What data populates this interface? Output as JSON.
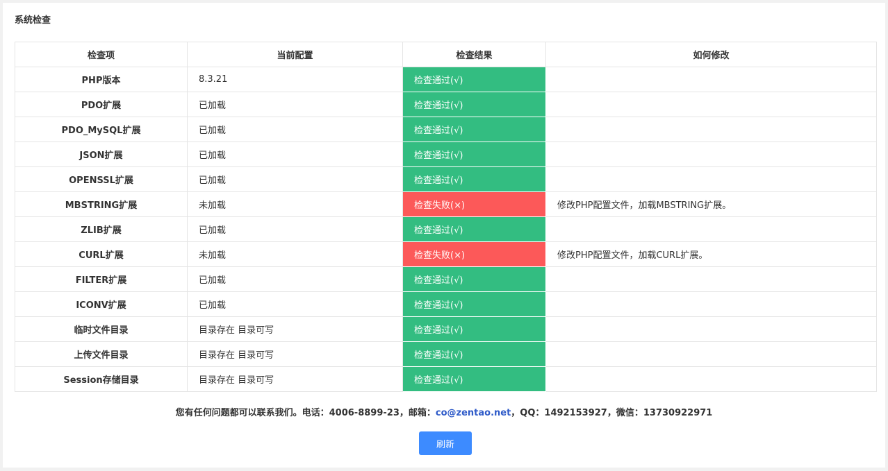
{
  "panel": {
    "title": "系统检查"
  },
  "table": {
    "headers": [
      "检查项",
      "当前配置",
      "检查结果",
      "如何修改"
    ],
    "rows": [
      {
        "item": "PHP版本",
        "config": "8.3.21",
        "result": "检查通过(√)",
        "status": "pass",
        "fix": ""
      },
      {
        "item": "PDO扩展",
        "config": "已加载",
        "result": "检查通过(√)",
        "status": "pass",
        "fix": ""
      },
      {
        "item": "PDO_MySQL扩展",
        "config": "已加载",
        "result": "检查通过(√)",
        "status": "pass",
        "fix": ""
      },
      {
        "item": "JSON扩展",
        "config": "已加载",
        "result": "检查通过(√)",
        "status": "pass",
        "fix": ""
      },
      {
        "item": "OPENSSL扩展",
        "config": "已加载",
        "result": "检查通过(√)",
        "status": "pass",
        "fix": ""
      },
      {
        "item": "MBSTRING扩展",
        "config": "未加载",
        "result": "检查失败(×)",
        "status": "fail",
        "fix": "修改PHP配置文件，加载MBSTRING扩展。"
      },
      {
        "item": "ZLIB扩展",
        "config": "已加载",
        "result": "检查通过(√)",
        "status": "pass",
        "fix": ""
      },
      {
        "item": "CURL扩展",
        "config": "未加载",
        "result": "检查失败(×)",
        "status": "fail",
        "fix": "修改PHP配置文件，加载CURL扩展。"
      },
      {
        "item": "FILTER扩展",
        "config": "已加载",
        "result": "检查通过(√)",
        "status": "pass",
        "fix": ""
      },
      {
        "item": "ICONV扩展",
        "config": "已加载",
        "result": "检查通过(√)",
        "status": "pass",
        "fix": ""
      },
      {
        "item": "临时文件目录",
        "config": "目录存在 目录可写",
        "result": "检查通过(√)",
        "status": "pass",
        "fix": ""
      },
      {
        "item": "上传文件目录",
        "config": "目录存在 目录可写",
        "result": "检查通过(√)",
        "status": "pass",
        "fix": ""
      },
      {
        "item": "Session存储目录",
        "config": "目录存在 目录可写",
        "result": "检查通过(√)",
        "status": "pass",
        "fix": ""
      }
    ]
  },
  "contact": {
    "prefix": "您有任何问题都可以联系我们。电话：4006-8899-23，邮箱：",
    "email": "co@zentao.net",
    "suffix": "，QQ：1492153927，微信：13730922971"
  },
  "refresh_label": "刷新",
  "colors": {
    "pass": "#33bd81",
    "fail": "#fc5959",
    "button": "#3d8bff",
    "link": "#2e5ac8"
  }
}
